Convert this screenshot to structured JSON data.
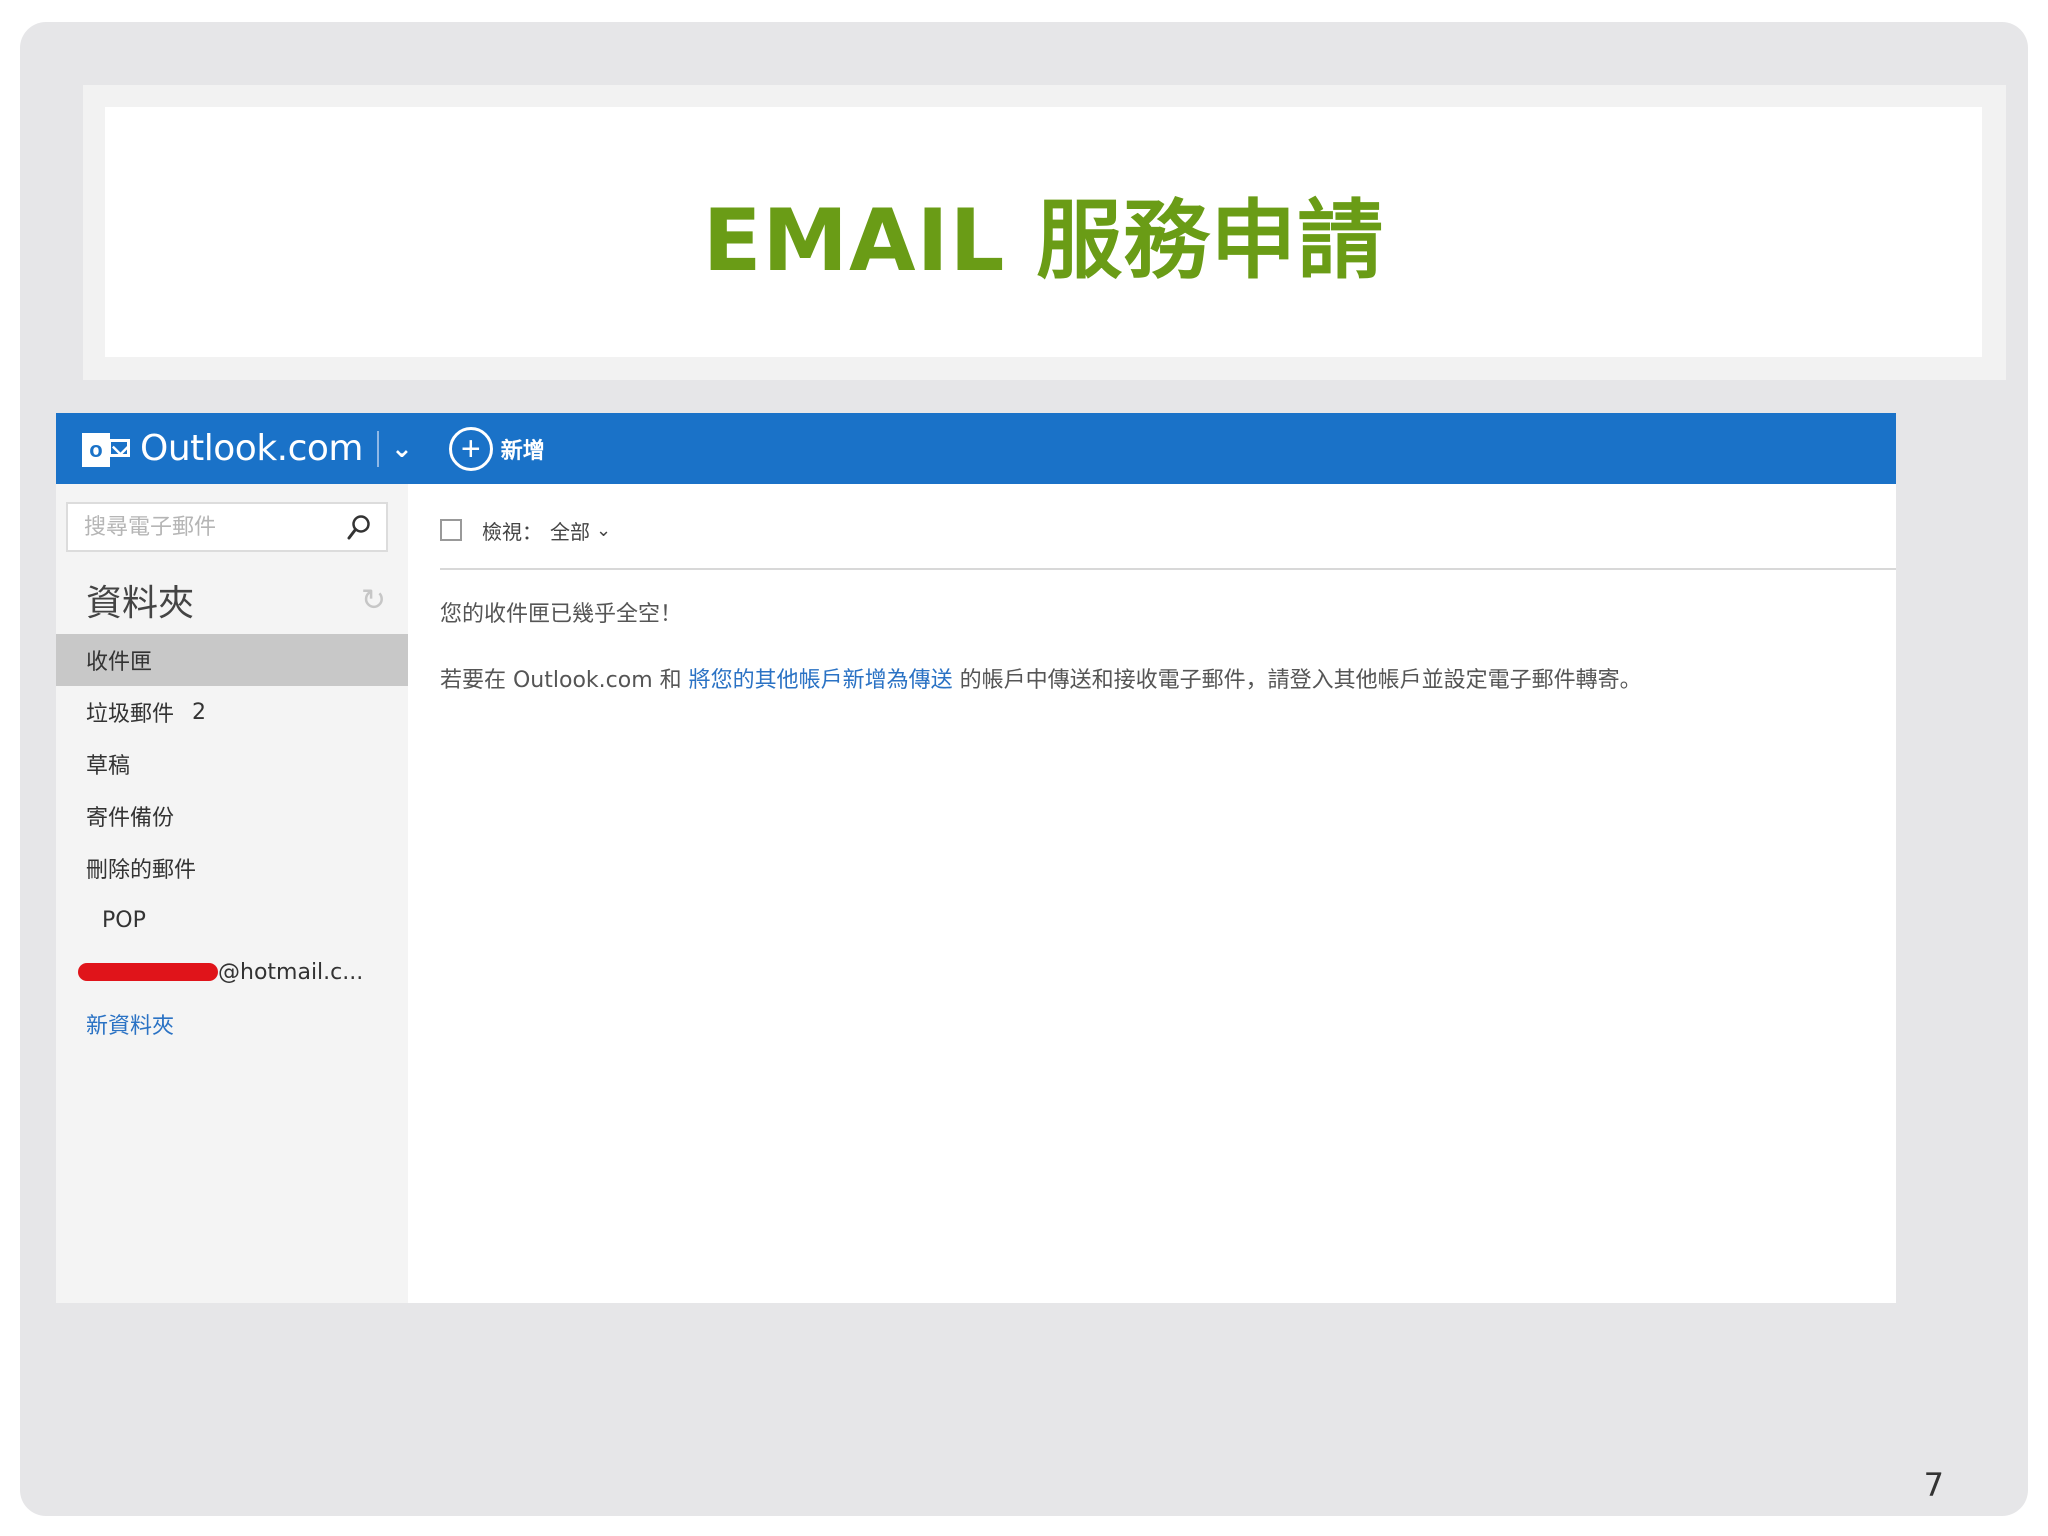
{
  "slide": {
    "title": "EMAIL 服務申請",
    "page_number": "7"
  },
  "outlook": {
    "brand": {
      "logo_letter": "o",
      "name": "Outlook.com",
      "chevron": "⌄"
    },
    "new_button": {
      "icon": "plus-circle-icon",
      "label": "新增"
    },
    "search": {
      "placeholder": "搜尋電子郵件",
      "icon": "search-icon"
    },
    "folders": {
      "title": "資料夾",
      "refresh_icon": "refresh-icon",
      "items": [
        {
          "label": "收件匣",
          "selected": true
        },
        {
          "label": "垃圾郵件",
          "count": "2"
        },
        {
          "label": "草稿"
        },
        {
          "label": "寄件備份"
        },
        {
          "label": "刪除的郵件"
        },
        {
          "label": "POP"
        },
        {
          "label": "@hotmail.c..."
        }
      ],
      "new_folder": "新資料夾"
    },
    "filter": {
      "label": "檢視：",
      "value": "全部",
      "chevron": "⌄"
    },
    "empty_state": {
      "title": "您的收件匣已幾乎全空！",
      "hint_prefix": "若要在 Outlook.com 和",
      "hint_link": "將您的其他帳戶新增為傳送",
      "hint_suffix": "的帳戶中傳送和接收電子郵件，請登入其他帳戶並設定電子郵件轉寄。"
    },
    "colors": {
      "topbar": "#1a72c8",
      "link": "#2a72c4",
      "title_green": "#6a9c16"
    }
  }
}
